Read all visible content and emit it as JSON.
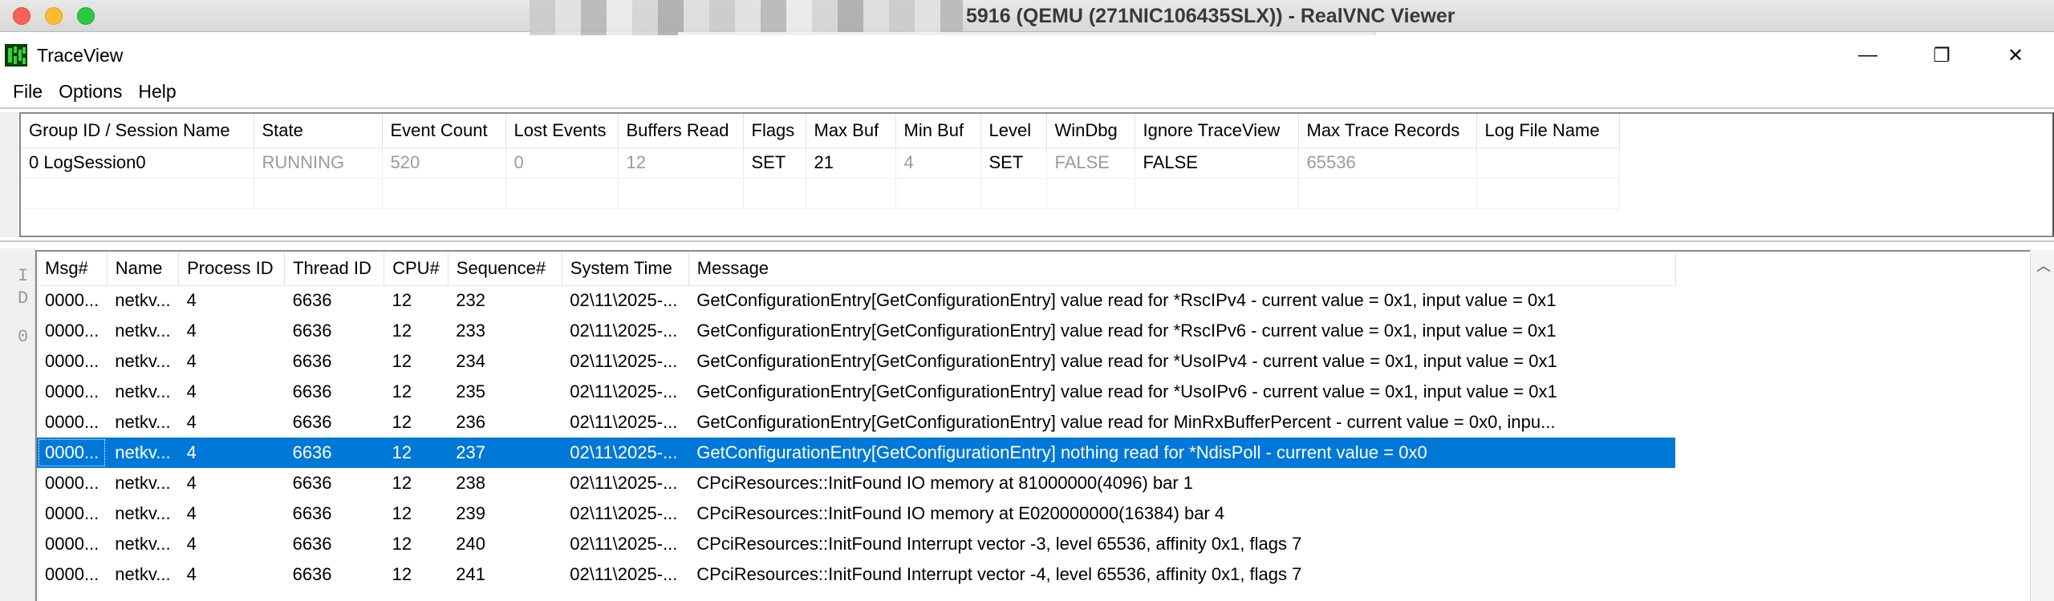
{
  "vnc": {
    "title": "5916 (QEMU (271NIC106435SLX)) - RealVNC Viewer"
  },
  "app": {
    "title": "TraceView",
    "controls": {
      "minimize": "—",
      "restore": "❐",
      "close": "✕"
    }
  },
  "menu": {
    "file": "File",
    "options": "Options",
    "help": "Help"
  },
  "session_table": {
    "headers": [
      "Group ID / Session Name",
      "State",
      "Event Count",
      "Lost Events",
      "Buffers Read",
      "Flags",
      "Max Buf",
      "Min Buf",
      "Level",
      "WinDbg",
      "Ignore TraceView",
      "Max Trace Records",
      "Log File Name"
    ],
    "rows": [
      [
        "0  LogSession0",
        "RUNNING",
        "520",
        "0",
        "12",
        "SET",
        "21",
        "4",
        "SET",
        "FALSE",
        "FALSE",
        "65536",
        ""
      ]
    ]
  },
  "gutter": {
    "glyphs": [
      "I",
      "D",
      "0"
    ]
  },
  "trace_table": {
    "headers": [
      "Msg#",
      "Name",
      "Process ID",
      "Thread ID",
      "CPU#",
      "Sequence#",
      "System Time",
      "Message"
    ],
    "selected_index": 5,
    "rows": [
      [
        "0000...",
        "netkv...",
        "4",
        "6636",
        "12",
        "232",
        "02\\11\\2025-...",
        "GetConfigurationEntry[GetConfigurationEntry] value read for *RscIPv4 - current value = 0x1, input value = 0x1"
      ],
      [
        "0000...",
        "netkv...",
        "4",
        "6636",
        "12",
        "233",
        "02\\11\\2025-...",
        "GetConfigurationEntry[GetConfigurationEntry] value read for *RscIPv6 - current value = 0x1, input value = 0x1"
      ],
      [
        "0000...",
        "netkv...",
        "4",
        "6636",
        "12",
        "234",
        "02\\11\\2025-...",
        "GetConfigurationEntry[GetConfigurationEntry] value read for *UsoIPv4 - current value = 0x1, input value = 0x1"
      ],
      [
        "0000...",
        "netkv...",
        "4",
        "6636",
        "12",
        "235",
        "02\\11\\2025-...",
        "GetConfigurationEntry[GetConfigurationEntry] value read for *UsoIPv6 - current value = 0x1, input value = 0x1"
      ],
      [
        "0000...",
        "netkv...",
        "4",
        "6636",
        "12",
        "236",
        "02\\11\\2025-...",
        "GetConfigurationEntry[GetConfigurationEntry] value read for MinRxBufferPercent - current value = 0x0, inpu..."
      ],
      [
        "0000...",
        "netkv...",
        "4",
        "6636",
        "12",
        "237",
        "02\\11\\2025-...",
        "GetConfigurationEntry[GetConfigurationEntry] nothing read for *NdisPoll - current value = 0x0"
      ],
      [
        "0000...",
        "netkv...",
        "4",
        "6636",
        "12",
        "238",
        "02\\11\\2025-...",
        "CPciResources::InitFound IO memory at 81000000(4096) bar 1"
      ],
      [
        "0000...",
        "netkv...",
        "4",
        "6636",
        "12",
        "239",
        "02\\11\\2025-...",
        "CPciResources::InitFound IO memory at E020000000(16384) bar 4"
      ],
      [
        "0000...",
        "netkv...",
        "4",
        "6636",
        "12",
        "240",
        "02\\11\\2025-...",
        "CPciResources::InitFound Interrupt vector -3, level 65536, affinity 0x1, flags 7"
      ],
      [
        "0000...",
        "netkv...",
        "4",
        "6636",
        "12",
        "241",
        "02\\11\\2025-...",
        "CPciResources::InitFound Interrupt vector -4, level 65536, affinity 0x1, flags 7"
      ]
    ]
  }
}
